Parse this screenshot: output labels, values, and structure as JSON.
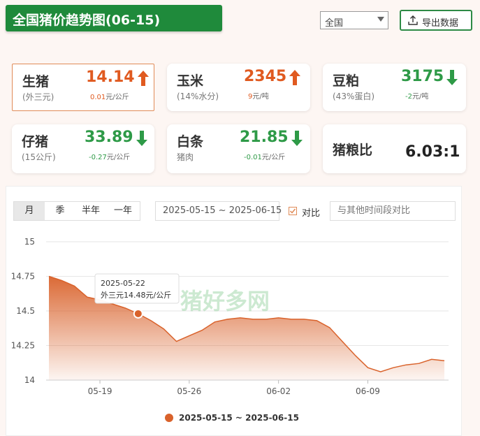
{
  "header": {
    "title": "全国猪价趋势图(06-15)",
    "region": "全国",
    "export_label": "导出数据"
  },
  "cards": [
    {
      "name": "生猪",
      "sub": "(外三元)",
      "price": "14.14",
      "direction": "up",
      "change_num": "0.01",
      "change_unit": "元/公斤",
      "active": true
    },
    {
      "name": "玉米",
      "sub": "(14%水分)",
      "price": "2345",
      "direction": "up",
      "change_num": "9",
      "change_unit": "元/吨",
      "active": false
    },
    {
      "name": "豆粕",
      "sub": "(43%蛋白)",
      "price": "3175",
      "direction": "down",
      "change_num": "-2",
      "change_unit": "元/吨",
      "active": false
    },
    {
      "name": "仔猪",
      "sub": "(15公斤)",
      "price": "33.89",
      "direction": "down",
      "change_num": "-0.27",
      "change_unit": "元/公斤",
      "active": false
    },
    {
      "name": "白条",
      "sub": "猪肉",
      "price": "21.85",
      "direction": "down",
      "change_num": "-0.01",
      "change_unit": "元/公斤",
      "active": false
    }
  ],
  "ratio": {
    "name": "猪粮比",
    "value": "6.03:1"
  },
  "colors": {
    "up": "#e05a20",
    "down": "#2e9a47",
    "brand": "#1f8a3b",
    "series": "#d9622b"
  },
  "controls": {
    "tabs": [
      "月",
      "季",
      "半年",
      "一年"
    ],
    "active_tab": "月",
    "date_range": "2025-05-15 ~ 2025-06-15",
    "compare_label": "对比",
    "compare_placeholder": "与其他时间段对比"
  },
  "watermark": "猪好多网",
  "chart_data": {
    "type": "area",
    "title": "",
    "xlabel": "",
    "ylabel": "",
    "ylim": [
      14,
      15
    ],
    "yticks": [
      "15",
      "14.75",
      "14.5",
      "14.25",
      "14"
    ],
    "xticks": [
      "05-19",
      "05-26",
      "06-02",
      "06-09"
    ],
    "grid": true,
    "legend_position": "bottom",
    "series": [
      {
        "name": "2025-05-15 ~ 2025-06-15",
        "x": [
          "2025-05-15",
          "2025-05-16",
          "2025-05-17",
          "2025-05-18",
          "2025-05-19",
          "2025-05-20",
          "2025-05-21",
          "2025-05-22",
          "2025-05-23",
          "2025-05-24",
          "2025-05-25",
          "2025-05-26",
          "2025-05-27",
          "2025-05-28",
          "2025-05-29",
          "2025-05-30",
          "2025-05-31",
          "2025-06-01",
          "2025-06-02",
          "2025-06-03",
          "2025-06-04",
          "2025-06-05",
          "2025-06-06",
          "2025-06-07",
          "2025-06-08",
          "2025-06-09",
          "2025-06-10",
          "2025-06-11",
          "2025-06-12",
          "2025-06-13",
          "2025-06-14",
          "2025-06-15"
        ],
        "values": [
          14.75,
          14.72,
          14.68,
          14.6,
          14.58,
          14.55,
          14.52,
          14.48,
          14.43,
          14.37,
          14.28,
          14.32,
          14.36,
          14.42,
          14.44,
          14.45,
          14.44,
          14.44,
          14.45,
          14.44,
          14.44,
          14.43,
          14.38,
          14.28,
          14.18,
          14.09,
          14.06,
          14.09,
          14.11,
          14.12,
          14.15,
          14.14
        ]
      }
    ],
    "tooltip": {
      "date": "2025-05-22",
      "label": "外三元14.48元/公斤"
    }
  }
}
